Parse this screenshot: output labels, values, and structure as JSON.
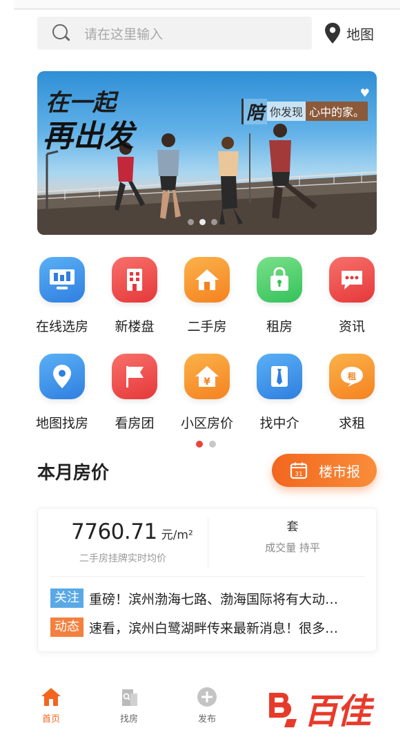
{
  "search": {
    "placeholder": "请在这里输入"
  },
  "map": {
    "label": "地图"
  },
  "banner": {
    "slogan_line1": "在一起",
    "slogan_line2": "再出发",
    "tag_accent": "陪",
    "tag_text": "你发现",
    "tag_text2": "心中的家。"
  },
  "grid": {
    "row1": [
      {
        "label": "在线选房",
        "icon": "computer-icon",
        "color": "#3a8ee8"
      },
      {
        "label": "新楼盘",
        "icon": "building-icon",
        "color": "#ef4a4a"
      },
      {
        "label": "二手房",
        "icon": "house-icon",
        "color": "#f7982f"
      },
      {
        "label": "租房",
        "icon": "lock-bag-icon",
        "color": "#4fcf6d"
      },
      {
        "label": "资讯",
        "icon": "chat-bubble-icon",
        "color": "#ef4a4a"
      }
    ],
    "row2": [
      {
        "label": "地图找房",
        "icon": "map-pin-icon",
        "color": "#3a8ee8"
      },
      {
        "label": "看房团",
        "icon": "flag-icon",
        "color": "#ef4a4a"
      },
      {
        "label": "小区房价",
        "icon": "house-yen-icon",
        "color": "#f7982f"
      },
      {
        "label": "找中介",
        "icon": "agent-tie-icon",
        "color": "#3a8ee8"
      },
      {
        "label": "求租",
        "icon": "rent-bubble-icon",
        "color": "#f7982f"
      }
    ]
  },
  "section": {
    "title": "本月房价",
    "report_label": "楼市报",
    "report_icon_text": "31"
  },
  "price": {
    "value": "7760.71",
    "unit": "元/m²",
    "desc": "二手房挂牌实时均价",
    "deal_unit": "套",
    "deal_desc": "成交量 持平"
  },
  "news": [
    {
      "tag": "关注",
      "tag_color": "#5aa9e6",
      "text": "重磅！滨州渤海七路、渤海国际将有大动…"
    },
    {
      "tag": "动态",
      "tag_color": "#f3803f",
      "text": "速看，滨州白鹭湖畔传来最新消息！很多…"
    }
  ],
  "nav": {
    "home": "首页",
    "find": "找房",
    "publish": "发布"
  },
  "watermark": {
    "text": "百佳"
  }
}
